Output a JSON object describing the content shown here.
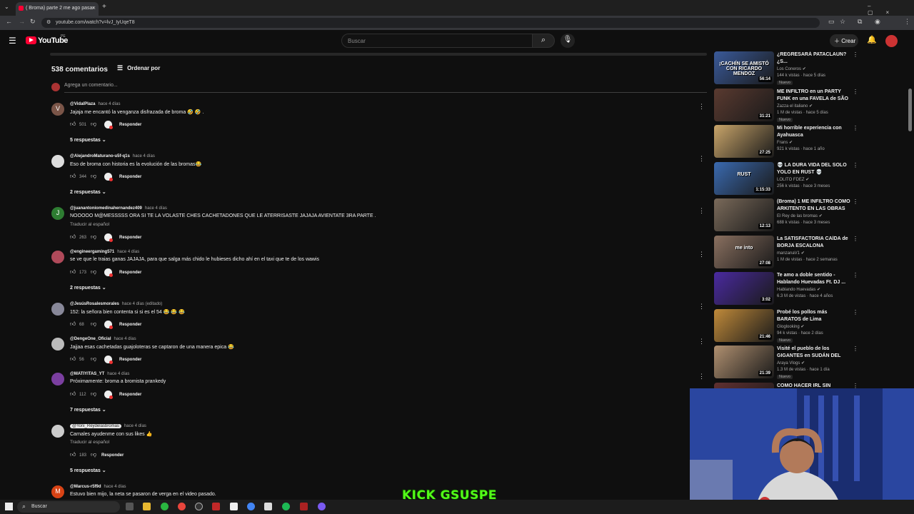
{
  "browser": {
    "tab_title": "( Broma) parte 2 me ago pasar",
    "url": "youtube.com/watch?v=lvJ_IyUqeT8"
  },
  "youtube": {
    "logo_text": "YouTube",
    "logo_region": "PE",
    "search_placeholder": "Buscar",
    "create_label": "Crear"
  },
  "comments_section": {
    "count_label": "538 comentarios",
    "sort_label": "Ordenar por",
    "add_placeholder": "Agrega un comentario...",
    "reply_label": "Responder",
    "translate_label": "Traducir al español",
    "comments": [
      {
        "initial": "V",
        "avatar_color": "#7a5548",
        "user": "@VidalPlaza",
        "time": "hace 4 días",
        "text": "Jajaja me encantó la venganza disfrazada de broma 🤣 🤣 .",
        "likes": "501",
        "replies": "5 respuestas"
      },
      {
        "initial": "",
        "avatar_color": "#ddd",
        "user": "@AlejandroMaturano-u5f-q1s",
        "time": "hace 4 días",
        "text": "Eso de broma con historia es la evolución de las bromas😂",
        "likes": "344",
        "replies": "2 respuestas"
      },
      {
        "initial": "J",
        "avatar_color": "#2e7d32",
        "user": "@juanantoniomedinahernandez409",
        "time": "hace 4 días",
        "text": "NOOOOO   M@MESSSSS   ORA SI TE LA VOLASTE CHES CACHETADONES QUE LE ATERRISASTE JAJAJA AVIENTATE 3RA PARTE .",
        "likes": "263",
        "replies": ""
      },
      {
        "initial": "",
        "avatar_color": "#b04a5a",
        "user": "@engineergaming571",
        "time": "hace 4 días",
        "text": "se ve que le traias ganas JAJAJA, para que salga más chido le hubieses dicho ahí en el taxi que te de los wawis",
        "likes": "173",
        "replies": "2 respuestas"
      },
      {
        "initial": "",
        "avatar_color": "#889",
        "user": "@JesúsRosalesmorales",
        "time": "hace 4 días (editado)",
        "text": "152: la señora bien contenta si si es el 54 😂 😂 😂",
        "likes": "68",
        "replies": ""
      },
      {
        "initial": "",
        "avatar_color": "#bbb",
        "user": "@DengeOne_Oficial",
        "time": "hace 4 días",
        "text": "Jajjaa esas cachetadas guajoloteras se captaron de una manera epica 😂",
        "likes": "56",
        "replies": ""
      },
      {
        "initial": "",
        "avatar_color": "#7b3fa0",
        "user": "@MATIYITAS_YT",
        "time": "hace 4 días",
        "text": "Próximamente: broma a bromista prankedy",
        "likes": "112",
        "replies": "7 respuestas"
      },
      {
        "initial": "",
        "avatar_color": "#ccc",
        "user": "@Yoni_Reydelasbromas",
        "time": "hace 4 días",
        "text": "Carnales ayudenme con sus likes 👍",
        "likes": "183",
        "replies": "5 respuestas"
      },
      {
        "initial": "M",
        "avatar_color": "#d84315",
        "user": "@Marcus-r5f9d",
        "time": "hace 4 días",
        "text": "Estuvo bien mijo, la neta se pasaron de verga en el video pasado.",
        "likes": "",
        "replies": ""
      }
    ]
  },
  "recommendations": [
    {
      "title": "¿REGRESARÁ PATACLAUN?¿S...",
      "channel": "Los Coneros",
      "meta": "144 k vistas · hace 5 días",
      "new": "Nuevo",
      "duration": "56:14",
      "thumb_color": "#3a5a9a",
      "thumb_text": "¡CACHÍN SE AMISTÓ CON RICARDO MENDOZ"
    },
    {
      "title": "ME INFILTRO en un PARTY FUNK en una FAVELA de SÃO ...",
      "channel": "Zazza el italiano",
      "meta": "1 M de vistas · hace 5 días",
      "new": "Nuevo",
      "duration": "31:21",
      "thumb_color": "#5a3a30",
      "thumb_text": ""
    },
    {
      "title": "Mi horrible experiencia con Ayahuasca",
      "channel": "Frans",
      "meta": "921 k vistas · hace 1 año",
      "new": "",
      "duration": "27:25",
      "thumb_color": "#c9a56a",
      "thumb_text": ""
    },
    {
      "title": "💀 LA DURA VIDA DEL SOLO YOLO EN RUST 💀",
      "channel": "LOLITO FDEZ",
      "meta": "256 k vistas · hace 3 meses",
      "new": "",
      "duration": "1:15:33",
      "thumb_color": "#3a6ab0",
      "thumb_text": "RUST"
    },
    {
      "title": "(Broma) 1 ME INFILTRO COMO ARKITENTO EN LAS OBRAS",
      "channel": "El Rey de las bromas",
      "meta": "688 k vistas · hace 3 meses",
      "new": "",
      "duration": "12:13",
      "thumb_color": "#7a6a5a",
      "thumb_text": ""
    },
    {
      "title": "La SATISFACTORIA CAÍDA de BORJA ESCALONA",
      "channel": "manzanaV1",
      "meta": "1 M de vistas · hace 2 semanas",
      "new": "",
      "duration": "27:08",
      "thumb_color": "#8a7060",
      "thumb_text": "me into"
    },
    {
      "title": "Te amo a doble sentido - Hablando Huevadas Ft. DJ ...",
      "channel": "Hablando Huevadas",
      "meta": "6.3 M de vistas · hace 4 años",
      "new": "",
      "duration": "3:02",
      "thumb_color": "#4a2aa0",
      "thumb_text": ""
    },
    {
      "title": "Probé los pollos más BARATOS de Lima",
      "channel": "Gloglooking",
      "meta": "94 k vistas · hace 2 días",
      "new": "Nuevo",
      "duration": "21:46",
      "thumb_color": "#c08a3a",
      "thumb_text": ""
    },
    {
      "title": "Visité el pueblo de los GIGANTES en SUDÁN DEL SU...",
      "channel": "Araya Vlogs",
      "meta": "1.3 M de vistas · hace 1 día",
      "new": "Nuevo",
      "duration": "21:39",
      "thumb_color": "#b09070",
      "thumb_text": ""
    },
    {
      "title": "COMO HACER IRL SIN GASTAR",
      "channel": "",
      "meta": "",
      "new": "",
      "duration": "",
      "thumb_color": "#603030",
      "thumb_text": ""
    }
  ],
  "overlay": {
    "kick_text": "KICK GSUSPE"
  },
  "taskbar": {
    "search_label": "Buscar"
  }
}
